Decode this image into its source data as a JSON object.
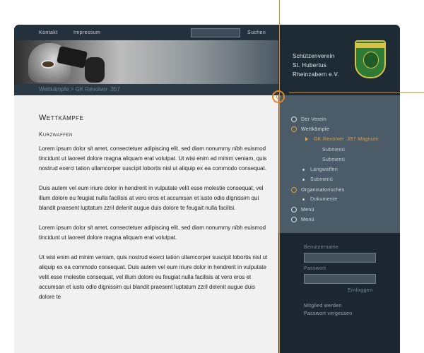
{
  "topnav": {
    "links": [
      "Kontakt",
      "Impressum"
    ],
    "search_label": "Suchen"
  },
  "breadcrumb": "Wettkämpfe > GK Revolver .357",
  "club": {
    "line1": "Schützenverein",
    "line2": "St. Hubertus",
    "line3": "Rheinzabern e.V."
  },
  "main": {
    "title": "Wettkämpfe",
    "subtitle": "Kurzwaffen",
    "paragraphs": [
      "Lorem ipsum dolor sit amet, consectetuer adipiscing elit, sed diam nonummy nibh euismod tincidunt ut laoreet dolore magna aliquam erat volutpat. Ut wisi enim ad minim veniam, quis nostrud exerci tation ullamcorper suscipit lobortis nisl ut aliquip ex ea commodo consequat.",
      "Duis autem vel eum iriure dolor in hendrerit in vulputate velit esse molestie consequat, vel illum dolore eu feugiat nulla facilisis at vero eros et accumsan et iusto odio dignissim qui blandit praesent luptatum zzril delenit augue duis dolore te feugait nulla facilisi.",
      "Lorem ipsum dolor sit amet, consectetuer adipiscing elit, sed diam nonummy nibh euismod tincidunt ut laoreet dolore magna aliquam erat volutpat.",
      "Ut wisi enim ad minim veniam, quis nostrud exerci tation ullamcorper suscipit lobortis nisl ut aliquip ex ea commodo consequat. Duis autem vel eum iriure dolor in hendrerit in vulputate velit esse molestie consequat, vel illum dolore eu feugiat nulla facilisis at vero eros et accumsan et iusto odio dignissim qui blandit praesent luptatum zzril delenit augue duis dolore te"
    ]
  },
  "sidenav": {
    "items": [
      {
        "label": "Der Verein",
        "type": "circle"
      },
      {
        "label": "Wettkämpfe",
        "type": "active"
      },
      {
        "label": "GK Revolver .357 Magnum",
        "type": "arrow"
      },
      {
        "label": "Submenü",
        "type": "none"
      },
      {
        "label": "Submenü",
        "type": "none"
      },
      {
        "label": "Langwaffen",
        "type": "dot"
      },
      {
        "label": "Submenü",
        "type": "dot"
      },
      {
        "label": "Organisatorisches",
        "type": "active"
      },
      {
        "label": "Dokumente",
        "type": "dot"
      },
      {
        "label": "Menü",
        "type": "circle"
      },
      {
        "label": "Menü",
        "type": "circle"
      }
    ]
  },
  "login": {
    "username_label": "Benutzername",
    "password_label": "Passwort",
    "submit_label": "Einloggen",
    "register_link": "Mitglied werden",
    "forgot_link": "Passwort vergessen"
  },
  "colors": {
    "accent": "#e28a22",
    "dark": "#23313d",
    "nav_bg": "#4b5c68"
  }
}
